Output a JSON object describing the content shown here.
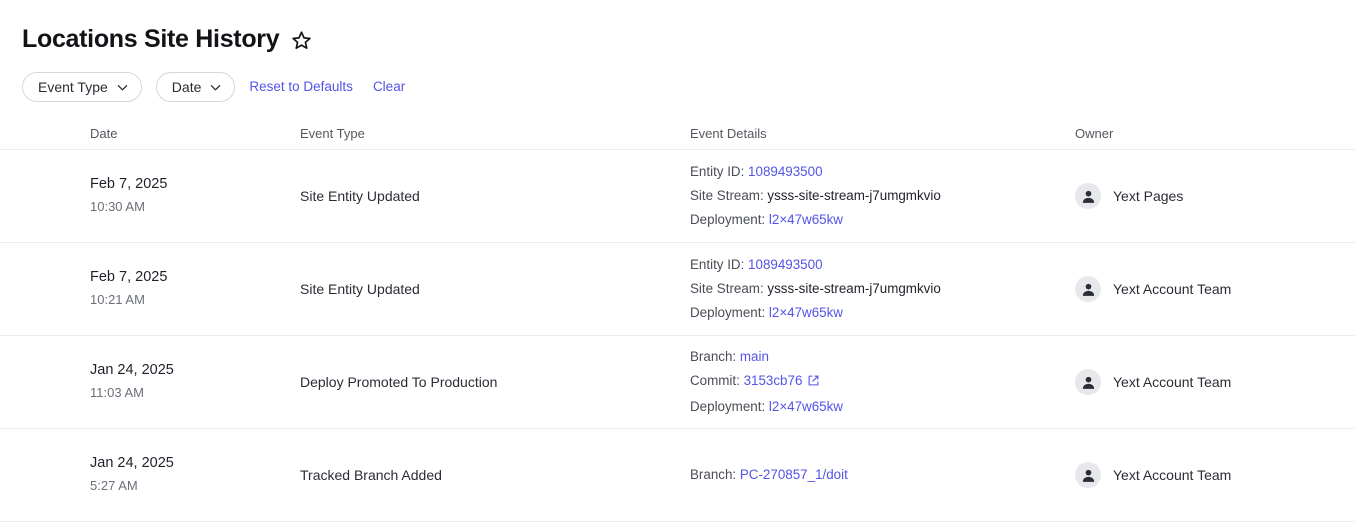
{
  "header": {
    "title": "Locations Site History",
    "favorite_icon": "star-icon"
  },
  "filters": {
    "chips": [
      {
        "label": "Event Type",
        "icon": "chevron-down-icon"
      },
      {
        "label": "Date",
        "icon": "chevron-down-icon"
      }
    ],
    "reset_label": "Reset to Defaults",
    "clear_label": "Clear"
  },
  "table": {
    "columns": [
      "Date",
      "Event Type",
      "Event Details",
      "Owner"
    ],
    "rows": [
      {
        "date": "Feb 7, 2025",
        "time": "10:30 AM",
        "event_type": "Site Entity Updated",
        "details": [
          {
            "label": "Entity ID:",
            "value": "1089493500",
            "link": true
          },
          {
            "label": "Site Stream:",
            "value": "ysss-site-stream-j7umgmkvio",
            "link": false
          },
          {
            "label": "Deployment:",
            "value": "l2×47w65kw",
            "link": true
          }
        ],
        "owner": "Yext Pages"
      },
      {
        "date": "Feb 7, 2025",
        "time": "10:21 AM",
        "event_type": "Site Entity Updated",
        "details": [
          {
            "label": "Entity ID:",
            "value": "1089493500",
            "link": true
          },
          {
            "label": "Site Stream:",
            "value": "ysss-site-stream-j7umgmkvio",
            "link": false
          },
          {
            "label": "Deployment:",
            "value": "l2×47w65kw",
            "link": true
          }
        ],
        "owner": "Yext Account Team"
      },
      {
        "date": "Jan 24, 2025",
        "time": "11:03 AM",
        "event_type": "Deploy Promoted To Production",
        "details": [
          {
            "label": "Branch:",
            "value": "main",
            "link": true
          },
          {
            "label": "Commit:",
            "value": "3153cb76",
            "link": true,
            "external_icon": "external-link-icon"
          },
          {
            "label": "Deployment:",
            "value": "l2×47w65kw",
            "link": true
          }
        ],
        "owner": "Yext Account Team"
      },
      {
        "date": "Jan 24, 2025",
        "time": "5:27 AM",
        "event_type": "Tracked Branch Added",
        "details": [
          {
            "label": "Branch:",
            "value": "PC-270857_1/doit",
            "link": true
          }
        ],
        "owner": "Yext Account Team"
      }
    ]
  },
  "colors": {
    "link": "#5454e8",
    "text": "#1f2129",
    "muted": "#6b6f78",
    "divider": "#ebecf0",
    "avatar_bg": "#e7e8ec"
  }
}
